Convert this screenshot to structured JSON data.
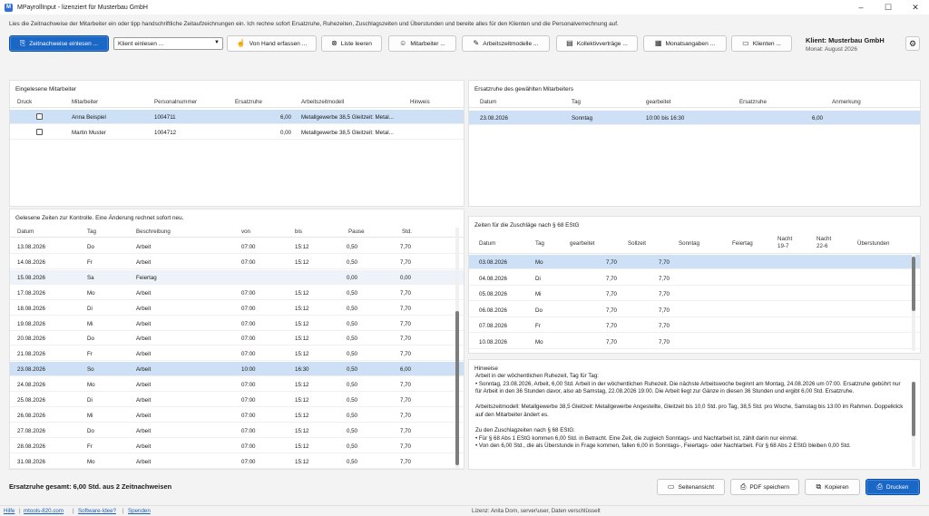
{
  "window": {
    "title": "MPayrollInput - lizenziert für Musterbau GmbH",
    "minimize": "–",
    "maximize": "☐",
    "close": "✕"
  },
  "intro": "Lies die Zeitnachweise der Mitarbeiter ein oder tipp handschriftliche Zeitaufzeichnungen ein. Ich rechne sofort Ersatzruhe, Ruhezeiten, Zuschlagszeiten und Überstunden und bereite alles für den Klienten und die Personalverrechnung auf.",
  "toolbar": {
    "read_timesheets": "Zeitnachweise einlesen ...",
    "client_select": "Klient einlesen ...",
    "manual_entry": "Von Hand erfassen ...",
    "clear_list": "Liste leeren",
    "employees": "Mitarbeiter ...",
    "work_models": "Arbeitszeitmodelle ...",
    "agreements": "Kollektivverträge ...",
    "monthly": "Monatsangaben ...",
    "clients": "Klienten ..."
  },
  "client_info": {
    "label": "Klient:",
    "name": "Musterbau GmbH",
    "month_label": "Monat:",
    "month": "August 2026"
  },
  "employees_panel": {
    "title": "Eingelesene Mitarbeiter",
    "columns": [
      "Druck",
      "Mitarbeiter",
      "Personalnummer",
      "Ersatzruhe",
      "Arbeitszeitmodell",
      "Hinweis"
    ],
    "rows": [
      {
        "name": "Anna Beispiel",
        "number": "1004711",
        "rest": "6,00",
        "model": "Metallgewerbe 38,5 Gleitzeit: Metal...",
        "note": "",
        "selected": true
      },
      {
        "name": "Martin Muster",
        "number": "1004712",
        "rest": "0,00",
        "model": "Metallgewerbe 38,5 Gleitzeit: Metal...",
        "note": "",
        "selected": false
      }
    ]
  },
  "rest_panel": {
    "title": "Ersatzruhe des gewählten Mitarbeiters",
    "columns": [
      "Datum",
      "Tag",
      "gearbeitet",
      "Ersatzruhe",
      "Anmerkung"
    ],
    "rows": [
      {
        "date": "23.08.2026",
        "day": "Sonntag",
        "worked": "10:00 bis 16:30",
        "rest": "6,00",
        "note": ""
      }
    ]
  },
  "times_panel": {
    "title": "Gelesene Zeiten zur Kontrolle. Eine Änderung rechnet sofort neu.",
    "columns": [
      "Datum",
      "Tag",
      "Beschreibung",
      "von",
      "bis",
      "Pause",
      "Std."
    ],
    "rows": [
      {
        "date": "13.08.2026",
        "day": "Do",
        "desc": "Arbeit",
        "from": "07:00",
        "to": "15:12",
        "pause": "0,50",
        "hours": "7,70"
      },
      {
        "date": "14.08.2026",
        "day": "Fr",
        "desc": "Arbeit",
        "from": "07:00",
        "to": "15:12",
        "pause": "0,50",
        "hours": "7,70"
      },
      {
        "date": "15.08.2026",
        "day": "Sa",
        "desc": "Feiertag",
        "from": "",
        "to": "",
        "pause": "0,00",
        "hours": "0,00"
      },
      {
        "date": "17.08.2026",
        "day": "Mo",
        "desc": "Arbeit",
        "from": "07:00",
        "to": "15:12",
        "pause": "0,50",
        "hours": "7,70"
      },
      {
        "date": "18.08.2026",
        "day": "Di",
        "desc": "Arbeit",
        "from": "07:00",
        "to": "15:12",
        "pause": "0,50",
        "hours": "7,70"
      },
      {
        "date": "19.08.2026",
        "day": "Mi",
        "desc": "Arbeit",
        "from": "07:00",
        "to": "15:12",
        "pause": "0,50",
        "hours": "7,70"
      },
      {
        "date": "20.08.2026",
        "day": "Do",
        "desc": "Arbeit",
        "from": "07:00",
        "to": "15:12",
        "pause": "0,50",
        "hours": "7,70"
      },
      {
        "date": "21.08.2026",
        "day": "Fr",
        "desc": "Arbeit",
        "from": "07:00",
        "to": "15:12",
        "pause": "0,50",
        "hours": "7,70"
      },
      {
        "date": "23.08.2026",
        "day": "So",
        "desc": "Arbeit",
        "from": "10:00",
        "to": "16:30",
        "pause": "0,50",
        "hours": "6,00"
      },
      {
        "date": "24.08.2026",
        "day": "Mo",
        "desc": "Arbeit",
        "from": "07:00",
        "to": "15:12",
        "pause": "0,50",
        "hours": "7,70"
      },
      {
        "date": "25.08.2026",
        "day": "Di",
        "desc": "Arbeit",
        "from": "07:00",
        "to": "15:12",
        "pause": "0,50",
        "hours": "7,70"
      },
      {
        "date": "26.08.2026",
        "day": "Mi",
        "desc": "Arbeit",
        "from": "07:00",
        "to": "15:12",
        "pause": "0,50",
        "hours": "7,70"
      },
      {
        "date": "27.08.2026",
        "day": "Do",
        "desc": "Arbeit",
        "from": "07:00",
        "to": "15:12",
        "pause": "0,50",
        "hours": "7,70"
      },
      {
        "date": "28.08.2026",
        "day": "Fr",
        "desc": "Arbeit",
        "from": "07:00",
        "to": "15:12",
        "pause": "0,50",
        "hours": "7,70"
      },
      {
        "date": "31.08.2026",
        "day": "Mo",
        "desc": "Arbeit",
        "from": "07:00",
        "to": "15:12",
        "pause": "0,50",
        "hours": "7,70"
      }
    ]
  },
  "surcharge_panel": {
    "title": "Zeiten für die Zuschläge nach § 68 EStG",
    "columns": [
      "Datum",
      "Tag",
      "gearbeitet",
      "Sollzeit",
      "Sonntag",
      "Feiertag",
      "Nacht 19-7",
      "Nacht 22-6",
      "Überstunden"
    ],
    "rows": [
      {
        "date": "03.08.2026",
        "day": "Mo",
        "worked": "7,70",
        "target": "7,70"
      },
      {
        "date": "04.08.2026",
        "day": "Di",
        "worked": "7,70",
        "target": "7,70"
      },
      {
        "date": "05.08.2026",
        "day": "Mi",
        "worked": "7,70",
        "target": "7,70"
      },
      {
        "date": "06.08.2026",
        "day": "Do",
        "worked": "7,70",
        "target": "7,70"
      },
      {
        "date": "07.08.2026",
        "day": "Fr",
        "worked": "7,70",
        "target": "7,70"
      },
      {
        "date": "10.08.2026",
        "day": "Mo",
        "worked": "7,70",
        "target": "7,70"
      }
    ]
  },
  "notes_panel": {
    "title": "Hinweise",
    "paragraphs": [
      "Arbeit in der wöchentlichen Ruhezeit, Tag für Tag:\n• Sonntag, 23.08.2026, Arbeit, 6,00 Std. Arbeit in der wöchentlichen Ruhezeit. Die nächste Arbeitswoche beginnt am Montag, 24.08.2026 um 07:00. Ersatzruhe gebührt nur für Arbeit in den 36 Stunden davor, also ab Samstag, 22.08.2026 19:00. Die Arbeit liegt zur Gänze in diesen 36 Stunden und ergibt 6,00 Std. Ersatzruhe.",
      "Arbeitszeitmodell: Metallgewerbe 38,5 Gleitzeit: Metallgewerbe Angestellte, Gleitzeit bis 10,0 Std. pro Tag, 38,5 Std. pro Woche, Samstag bis 13:00 im Rahmen. Doppelklick auf den Mitarbeiter ändert es.",
      "Zu den Zuschlagzeiten nach § 68 EStG:\n• Für § 68 Abs 1 EStG kommen 6,00 Std. in Betracht. Eine Zeit, die zugleich Sonntags- und Nachtarbeit ist, zählt darin nur einmal.\n• Von den 6,00 Std., die als Überstunde in Frage kommen, fallen 6,00 in Sonntags-, Feiertags- oder Nachtarbeit. Für § 68 Abs 2 EStG bleiben 0,00 Std."
    ]
  },
  "footer": {
    "total": "Ersatzruhe gesamt: 6,00 Std. aus 2 Zeitnachweisen",
    "preview": "Seitenansicht",
    "pdf": "PDF speichern",
    "copy": "Kopieren",
    "print": "Drucken"
  },
  "statusbar": {
    "help": "Hilfe",
    "website": "mtools-820.com",
    "idea": "Software-Idee?",
    "donate": "Spenden",
    "license": "Lizenz: Anita Dorn, server\\user, Daten verschlüsselt"
  },
  "colors": {
    "accent": "#1a67c6",
    "selection": "#cde0f6",
    "alt_row": "#eef3f9"
  }
}
